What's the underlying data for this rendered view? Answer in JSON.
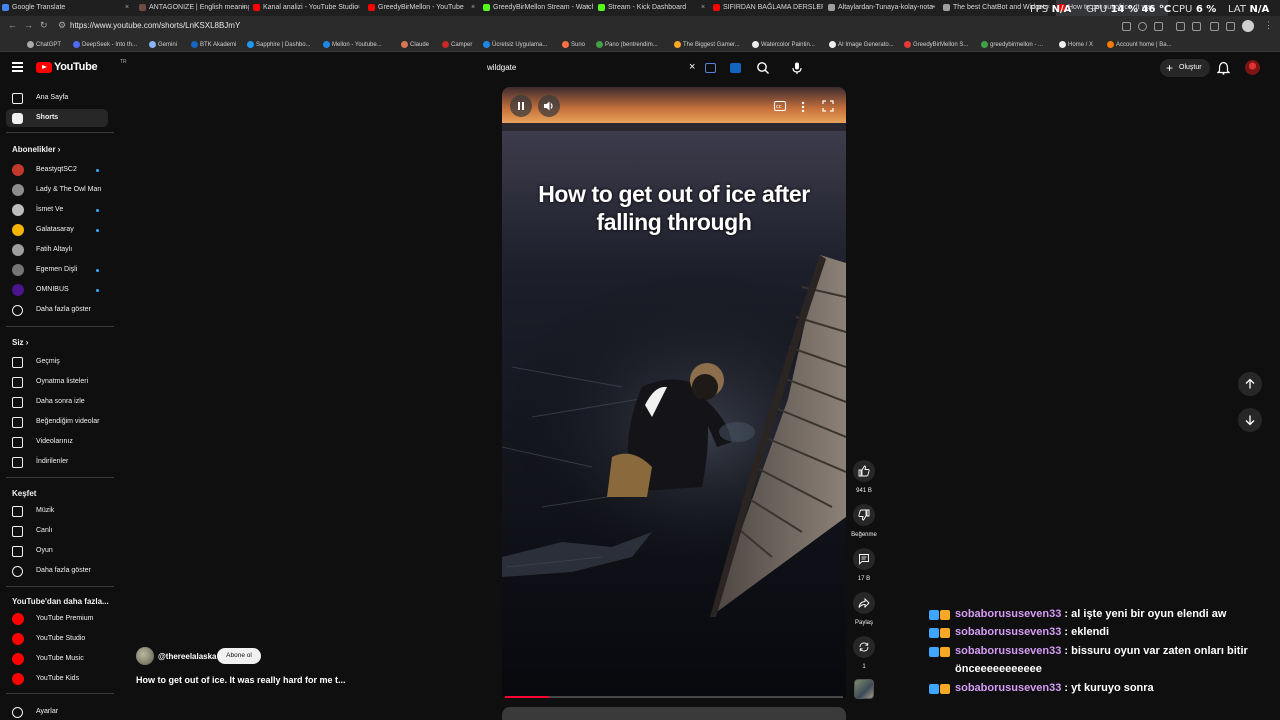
{
  "browser": {
    "tabs": [
      {
        "label": "Google Translate",
        "fav": "#4285f4"
      },
      {
        "label": "ANTAGONIZE | English meaning",
        "fav": "#6d4c41"
      },
      {
        "label": "Kanal analizi - YouTube Studio",
        "fav": "#ff0000"
      },
      {
        "label": "GreedyBirMellon - YouTube",
        "fav": "#ff0000"
      },
      {
        "label": "GreedyBirMellon Stream - Watch",
        "fav": "#53fc18"
      },
      {
        "label": "Stream - Kick Dashboard",
        "fav": "#53fc18"
      },
      {
        "label": "SIFIRDAN BAĞLAMA DERSLERİ",
        "fav": "#ff0000"
      },
      {
        "label": "Altaylardan-Tunaya-kolay-nota-",
        "fav": "#9e9e9e"
      },
      {
        "label": "The best ChatBot and Widgets",
        "fav": "#9e9e9e"
      },
      {
        "label": "How to get out of ice. It was",
        "fav": "#ff0000"
      }
    ],
    "close_glyph": "×",
    "perf": {
      "fps_label": "FPS",
      "fps_value": "N/A",
      "gpu_label": "GPU",
      "gpu_value": "14 %",
      "gpu_temp": "46 °C",
      "cpu_label": "CPU",
      "cpu_value": "6 %",
      "lat_label": "LAT",
      "lat_value": "N/A"
    },
    "url": "https://www.youtube.com/shorts/LnKSXL8BJmY",
    "bookmarks": [
      {
        "label": "ChatGPT",
        "fav": "#aaaaaa"
      },
      {
        "label": "DeepSeek - Into th...",
        "fav": "#4d6bfe"
      },
      {
        "label": "Gemini",
        "fav": "#8ab4f8"
      },
      {
        "label": "BTK Akademi",
        "fav": "#1565c0"
      },
      {
        "label": "Sapphire | Dashbo...",
        "fav": "#2196f3"
      },
      {
        "label": "Mellon - Youtube...",
        "fav": "#1e88e5"
      },
      {
        "label": "Claude",
        "fav": "#d97757"
      },
      {
        "label": "Camper",
        "fav": "#c62828"
      },
      {
        "label": "Ücretsiz Uygulama...",
        "fav": "#1e88e5"
      },
      {
        "label": "Suno",
        "fav": "#ff7043"
      },
      {
        "label": "Pano (bentrendim...",
        "fav": "#43a047"
      },
      {
        "label": "The Biggest Gamer...",
        "fav": "#f9a825"
      },
      {
        "label": "Watercolor Paintin...",
        "fav": "#eeeeee"
      },
      {
        "label": "AI Image Generato...",
        "fav": "#eeeeee"
      },
      {
        "label": "GreedyBirMellon S...",
        "fav": "#e53935"
      },
      {
        "label": "greedybirmellon - ...",
        "fav": "#43a047"
      },
      {
        "label": "Home / X",
        "fav": "#eeeeee"
      },
      {
        "label": "Account home | Ba...",
        "fav": "#f57c00"
      }
    ]
  },
  "header": {
    "logo_text": "YouTube",
    "country_code": "TR",
    "search_value": "wildgate",
    "clear_glyph": "×",
    "create_label": "Oluştur"
  },
  "sidebar": {
    "main": [
      {
        "label": "Ana Sayfa",
        "icon": "home-icon"
      },
      {
        "label": "Shorts",
        "icon": "shorts-icon"
      }
    ],
    "subs_heading": "Abonelikler",
    "subs": [
      {
        "label": "BeastyqtSC2",
        "color": "#c0392b",
        "live": true
      },
      {
        "label": "Lady & The Owl Man",
        "color": "#8d8d8d",
        "live": false
      },
      {
        "label": "İsmet Ve",
        "color": "#bdbdbd",
        "live": true
      },
      {
        "label": "Galatasaray",
        "color": "#f4b400",
        "live": true
      },
      {
        "label": "Fatih Altaylı",
        "color": "#9e9e9e",
        "live": false
      },
      {
        "label": "Egemen Dişli",
        "color": "#757575",
        "live": true
      },
      {
        "label": "OMNIBUS",
        "color": "#4a148c",
        "live": true
      }
    ],
    "subs_more": "Daha fazla göster",
    "you_heading": "Siz",
    "you": [
      {
        "label": "Geçmiş",
        "icon": "history-icon"
      },
      {
        "label": "Oynatma listeleri",
        "icon": "playlist-icon"
      },
      {
        "label": "Daha sonra izle",
        "icon": "clock-icon"
      },
      {
        "label": "Beğendiğim videolar",
        "icon": "thumb-up-icon"
      },
      {
        "label": "Videolarınız",
        "icon": "video-icon"
      },
      {
        "label": "İndirilenler",
        "icon": "download-icon"
      }
    ],
    "explore_heading": "Keşfet",
    "explore": [
      {
        "label": "Müzik",
        "icon": "music-icon"
      },
      {
        "label": "Canlı",
        "icon": "live-icon"
      },
      {
        "label": "Oyun",
        "icon": "gamepad-icon"
      }
    ],
    "explore_more": "Daha fazla göster",
    "more_heading": "YouTube'dan daha fazla...",
    "more": [
      {
        "label": "YouTube Premium"
      },
      {
        "label": "YouTube Studio"
      },
      {
        "label": "YouTube Music"
      },
      {
        "label": "YouTube Kids"
      }
    ],
    "settings": "Ayarlar"
  },
  "short": {
    "overlay_title_line1": "How to get out of ice after",
    "overlay_title_line2": "falling through",
    "progress": 0.13,
    "channel": "@thereelalaska",
    "subscribe": "Abone ol",
    "title": "How to get out of ice. It was really hard for me t...",
    "actions": {
      "likes": "941 B",
      "dislike": "Beğenme",
      "comments": "17 B",
      "share": "Paylaş",
      "remix": "1"
    }
  },
  "chat": [
    {
      "user": "sobaborususeven33",
      "sep": " : ",
      "text": "al işte yeni bir oyun elendi aw"
    },
    {
      "user": "sobaborususeven33",
      "sep": " : ",
      "text": "eklendi"
    },
    {
      "user": "sobaborususeven33",
      "sep": " : ",
      "text": "bissuru oyun var zaten onları bitir önceeeeeeeeeee"
    },
    {
      "user": "sobaborususeven33",
      "sep": " : ",
      "text": "yt kuruyo sonra"
    }
  ],
  "colors": {
    "accent_red": "#ff0000",
    "live_dot": "#3ea6ff",
    "chat_user": "#d59bf6"
  }
}
